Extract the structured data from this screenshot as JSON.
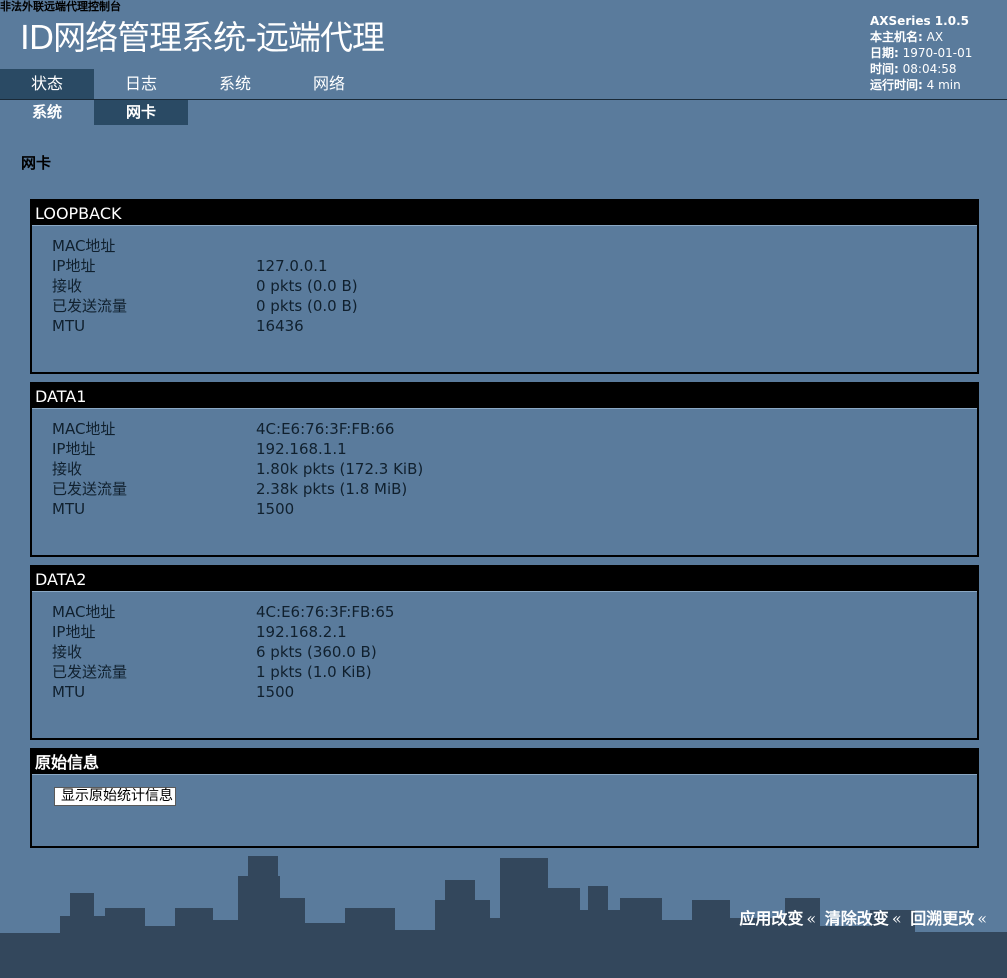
{
  "top_note": "非法外联远端代理控制台",
  "app_title": "ID网络管理系统-远端代理",
  "info": {
    "version": "AXSeries 1.0.5",
    "hostname_label": "本主机名:",
    "hostname": "AX",
    "date_label": "日期:",
    "date": "1970-01-01",
    "time_label": "时间:",
    "time": "08:04:58",
    "uptime_label": "运行时间:",
    "uptime": "4 min"
  },
  "main_nav": [
    "状态",
    "日志",
    "系统",
    "网络"
  ],
  "sub_nav": [
    "系统",
    "网卡"
  ],
  "page_title": "网卡",
  "interfaces": [
    {
      "name": "LOOPBACK",
      "rows": [
        {
          "label": "MAC地址",
          "value": ""
        },
        {
          "label": "IP地址",
          "value": "127.0.0.1"
        },
        {
          "label": "接收",
          "value": "0 pkts (0.0 B)"
        },
        {
          "label": "已发送流量",
          "value": "0 pkts (0.0 B)"
        },
        {
          "label": "MTU",
          "value": "16436"
        }
      ]
    },
    {
      "name": "DATA1",
      "rows": [
        {
          "label": "MAC地址",
          "value": "4C:E6:76:3F:FB:66"
        },
        {
          "label": "IP地址",
          "value": "192.168.1.1"
        },
        {
          "label": "接收",
          "value": "1.80k pkts (172.3 KiB)"
        },
        {
          "label": "已发送流量",
          "value": "2.38k pkts (1.8 MiB)"
        },
        {
          "label": "MTU",
          "value": "1500"
        }
      ]
    },
    {
      "name": "DATA2",
      "rows": [
        {
          "label": "MAC地址",
          "value": "4C:E6:76:3F:FB:65"
        },
        {
          "label": "IP地址",
          "value": "192.168.2.1"
        },
        {
          "label": "接收",
          "value": "6 pkts (360.0 B)"
        },
        {
          "label": "已发送流量",
          "value": "1 pkts (1.0 KiB)"
        },
        {
          "label": "MTU",
          "value": "1500"
        }
      ]
    }
  ],
  "raw_info": {
    "title": "原始信息",
    "button": "显示原始统计信息"
  },
  "footer": {
    "apply": "应用改变",
    "clear": "清除改变",
    "revert": "回溯更改",
    "separator": "«"
  }
}
